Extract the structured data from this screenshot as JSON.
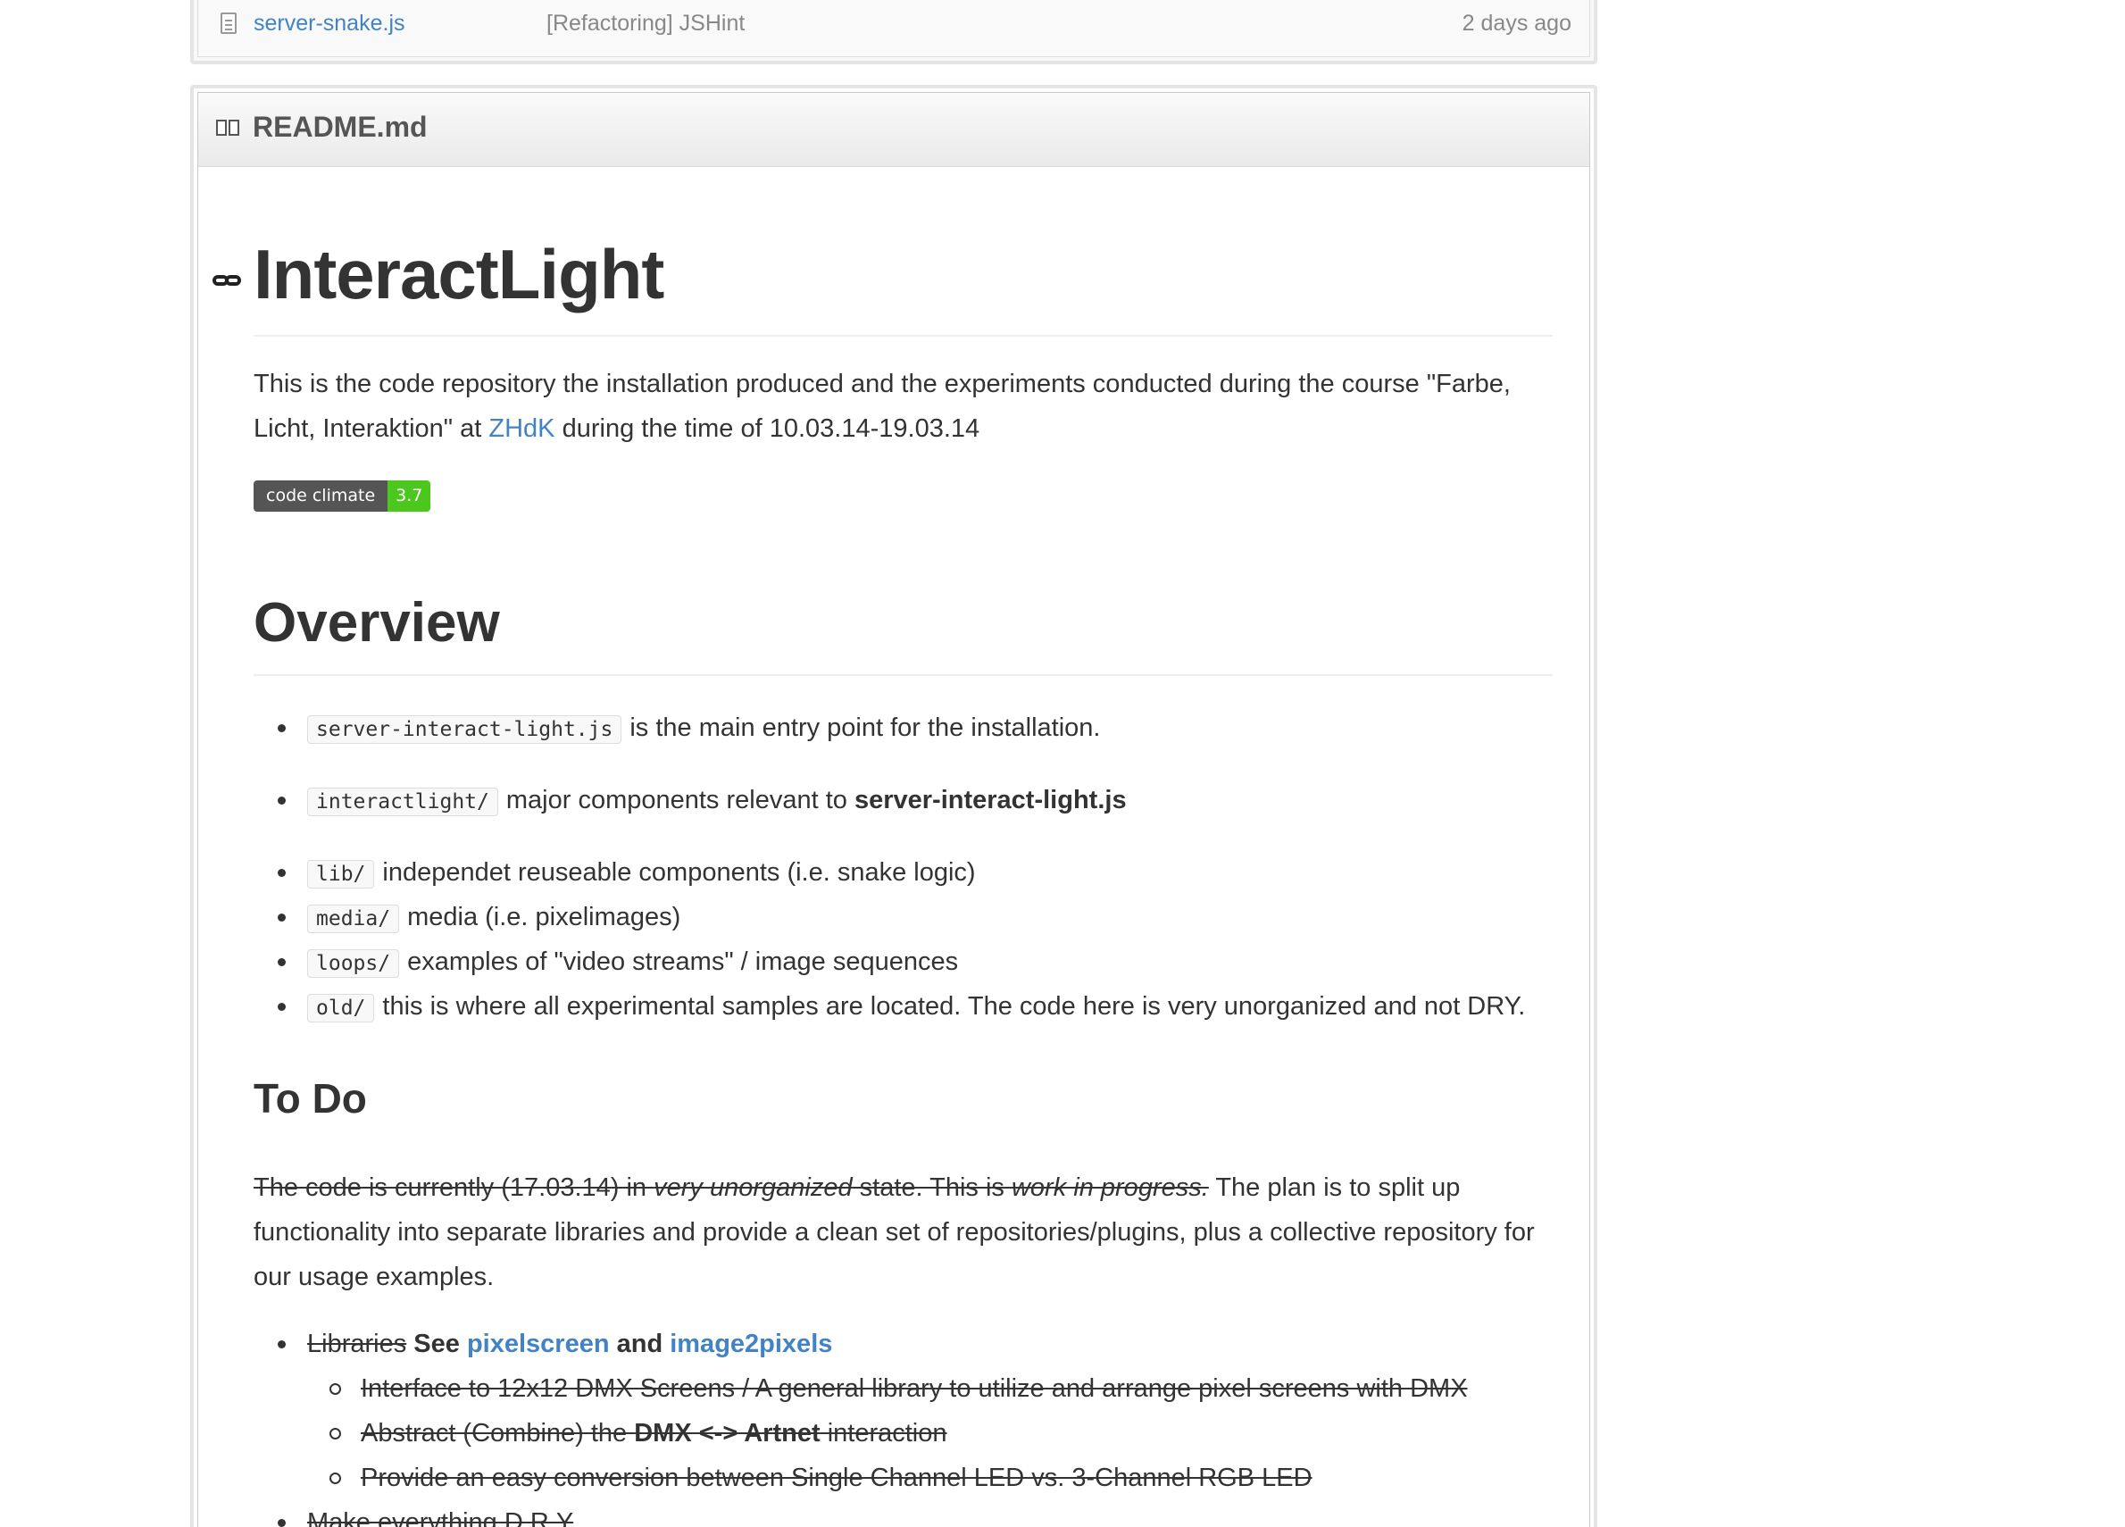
{
  "file_row": {
    "name": "server-snake.js",
    "message": "[Refactoring] JSHint",
    "age": "2 days ago"
  },
  "readme": {
    "filename": "README.md",
    "title": "InteractLight",
    "intro_before": "This is the code repository the installation produced and the experiments conducted during the course \"Farbe, Licht, Interaktion\" at ",
    "intro_link": "ZHdK",
    "intro_after": " during the time of 10.03.14-19.03.14",
    "badge_label": "code climate",
    "badge_value": "3.7",
    "overview_heading": "Overview",
    "overview_items": [
      {
        "code": "server-interact-light.js",
        "text": "is the main entry point for the installation.",
        "bold": ""
      },
      {
        "code": "interactlight/",
        "text": "major components relevant to ",
        "bold": "server-interact-light.js"
      },
      {
        "code": "lib/",
        "text": "independet reuseable components (i.e. snake logic)",
        "bold": ""
      },
      {
        "code": "media/",
        "text": "media (i.e. pixelimages)",
        "bold": ""
      },
      {
        "code": "loops/",
        "text": "examples of \"video streams\" / image sequences",
        "bold": ""
      },
      {
        "code": "old/",
        "text": "this is where all experimental samples are located. The code here is very unorganized and not DRY.",
        "bold": ""
      }
    ],
    "todo_heading": "To Do",
    "todo_strike_1": "The code is currently (17.03.14) in ",
    "todo_strike_em_1": "very unorganized",
    "todo_strike_2": " state. This is ",
    "todo_strike_em_2": "work in progress.",
    "todo_rest": " The plan is to split up functionality into separate libraries and provide a clean set of repositories/plugins, plus a collective repository for our usage examples.",
    "todo_items": {
      "libraries_strike": "Libraries",
      "libraries_see": " See ",
      "link_1": "pixelscreen",
      "and": " and ",
      "link_2": "image2pixels",
      "sub_1": "Interface to 12x12 DMX Screens / A general library to utilize and arrange pixel screens with DMX",
      "sub_2_before": "Abstract (Combine) the ",
      "sub_2_bold": "DMX <-> Artnet",
      "sub_2_after": " interaction",
      "sub_3": "Provide an easy conversion between Single Channel LED vs. 3-Channel RGB LED",
      "dry": "Make everything D.R.Y"
    }
  }
}
